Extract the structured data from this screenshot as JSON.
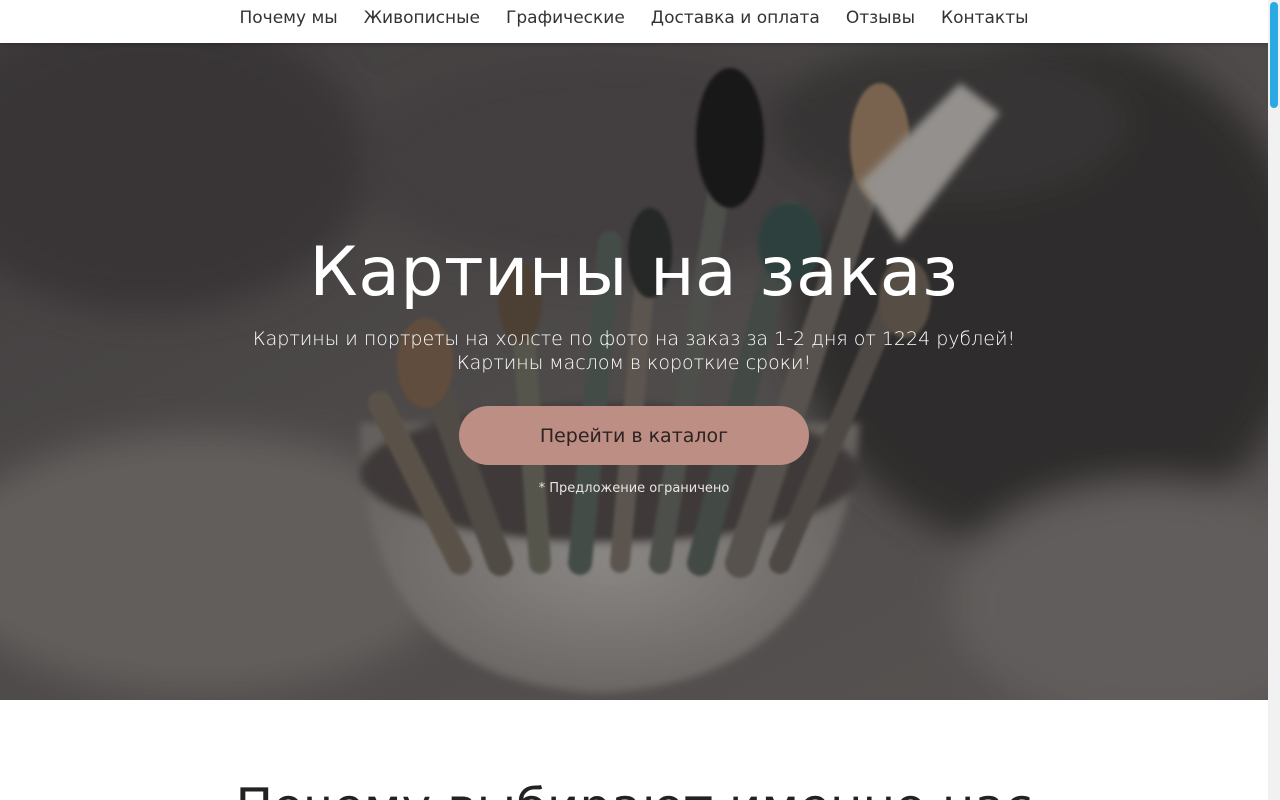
{
  "nav": {
    "items": [
      {
        "label": "Почему мы"
      },
      {
        "label": "Живописные"
      },
      {
        "label": "Графические"
      },
      {
        "label": "Доставка и оплата"
      },
      {
        "label": "Отзывы"
      },
      {
        "label": "Контакты"
      }
    ]
  },
  "hero": {
    "title": "Картины на заказ",
    "subtitle_line1": "Картины и портреты на холсте по фото на заказ за 1-2 дня от 1224 рублей!",
    "subtitle_line2": "Картины маслом в короткие сроки!",
    "cta_label": "Перейти в каталог",
    "note": "* Предложение ограничено",
    "background_image": "paint-brushes-in-jar-photo"
  },
  "why_section": {
    "title": "Почему выбирают именно нас"
  },
  "colors": {
    "accent": "#bd8f84",
    "scroll_thumb": "#2aa9e4",
    "nav_text": "#333333"
  }
}
